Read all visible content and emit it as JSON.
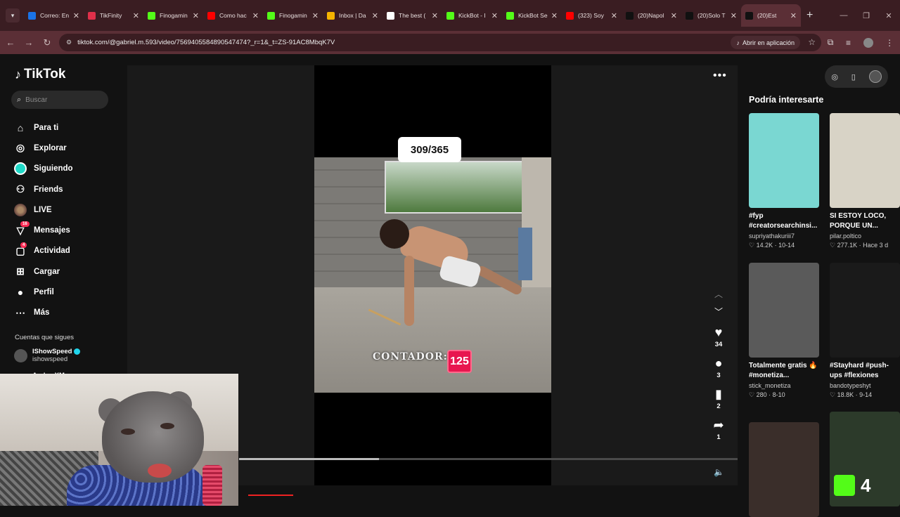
{
  "browser": {
    "tabs": [
      {
        "label": "Correo: En",
        "color": "#1a73e8"
      },
      {
        "label": "TikFinity",
        "color": "#e0304a"
      },
      {
        "label": "Finogamin",
        "color": "#53fc18"
      },
      {
        "label": "Como hac",
        "color": "#ff0000"
      },
      {
        "label": "Finogamin",
        "color": "#53fc18"
      },
      {
        "label": "Inbox | Da",
        "color": "#f5b400"
      },
      {
        "label": "The best (",
        "color": "#ffffff"
      },
      {
        "label": "KickBot - I",
        "color": "#53fc18"
      },
      {
        "label": "KickBot Se",
        "color": "#53fc18"
      },
      {
        "label": "(323) Soy",
        "color": "#ff0000"
      },
      {
        "label": "(20)Napol",
        "color": "#111111"
      },
      {
        "label": "(20)Solo T",
        "color": "#111111"
      },
      {
        "label": "(20)Est",
        "color": "#111111"
      }
    ],
    "url": "tiktok.com/@gabriel.m.593/video/7569405584890547474?_r=1&_t=ZS-91AC8MbqK7V",
    "open_app_label": "Abrir en aplicación"
  },
  "tiktok": {
    "logo": "TikTok",
    "search_placeholder": "Buscar",
    "nav": [
      {
        "label": "Para ti",
        "icon": "home-icon"
      },
      {
        "label": "Explorar",
        "icon": "compass-icon"
      },
      {
        "label": "Siguiendo",
        "icon": "following-icon"
      },
      {
        "label": "Friends",
        "icon": "friends-icon"
      },
      {
        "label": "LIVE",
        "icon": "live-icon"
      },
      {
        "label": "Mensajes",
        "icon": "messages-icon",
        "badge": "16"
      },
      {
        "label": "Actividad",
        "icon": "activity-icon",
        "badge": "4"
      },
      {
        "label": "Cargar",
        "icon": "upload-icon"
      },
      {
        "label": "Perfil",
        "icon": "profile-icon"
      },
      {
        "label": "Más",
        "icon": "more-icon"
      }
    ],
    "following_title": "Cuentas que sigues",
    "following": [
      {
        "name": "IShowSpeed",
        "handle": "ishowspeed"
      }
    ],
    "following_partial": "Andes XM"
  },
  "video": {
    "day_counter": "309/365",
    "contador_label": "CONTADOR:",
    "contador_value": "125",
    "progress": 0.28,
    "likes": "34",
    "comments": "3",
    "saves": "2",
    "shares": "1"
  },
  "recommendations": {
    "title": "Podría interesarte",
    "items": [
      {
        "title": "#fyp\n#creatorsearchinsi...",
        "author": "supriyathakuriii7",
        "likes": "14.2K",
        "date": "10-14",
        "thumb": "#7ad7d2"
      },
      {
        "title": "SI ESTOY LOCO,\nPORQUE UN...",
        "author": "pilar.poltico",
        "likes": "277.1K",
        "date": "Hace 3 d",
        "thumb": "#d8d3c6"
      },
      {
        "title": "Totalmente gratis 🔥\n#monetiza...",
        "author": "stick_monetiza",
        "likes": "280",
        "date": "8-10",
        "thumb": "#5a5a5a"
      },
      {
        "title": "#Stayhard #push-\nups #flexiones",
        "author": "bandotypeshyt",
        "likes": "18.8K",
        "date": "9-14",
        "thumb": "#1a1a1a"
      },
      {
        "title": "",
        "author": "",
        "likes": "",
        "date": "",
        "thumb": "#3a2e2a"
      },
      {
        "title": "",
        "author": "",
        "likes": "",
        "date": "",
        "thumb": "#2c3a2a"
      }
    ],
    "overlay_badge": "4"
  }
}
